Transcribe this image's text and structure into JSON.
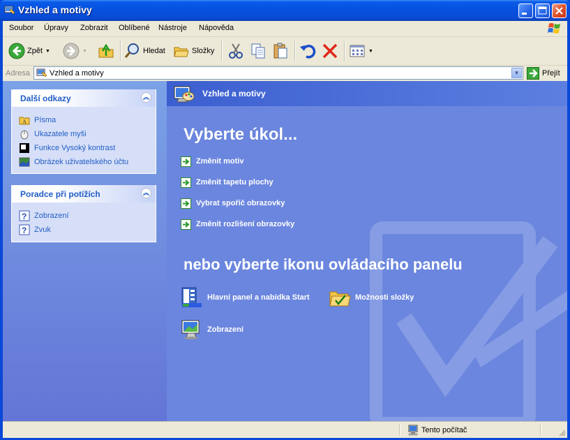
{
  "window": {
    "title": "Vzhled a motivy"
  },
  "menu": [
    "Soubor",
    "Úpravy",
    "Zobrazit",
    "Oblíbené",
    "Nástroje",
    "Nápověda"
  ],
  "toolbar": {
    "back": "Zpět",
    "search": "Hledat",
    "folders": "Složky"
  },
  "address": {
    "label": "Adresa",
    "value": "Vzhled a motivy",
    "go": "Přejít"
  },
  "sidebar": {
    "links_title": "Další odkazy",
    "links": [
      "Písma",
      "Ukazatele myši",
      "Funkce Vysoký kontrast",
      "Obrázek uživatelského účtu"
    ],
    "trouble_title": "Poradce při potížích",
    "trouble": [
      "Zobrazení",
      "Zvuk"
    ]
  },
  "main": {
    "header": "Vzhled a motivy",
    "pick_task": "Vyberte úkol...",
    "tasks": [
      "Změnit motiv",
      "Změnit tapetu plochy",
      "Vybrat spořič obrazovky",
      "Změnit rozlišení obrazovky"
    ],
    "pick_icon": "nebo vyberte ikonu ovládacího panelu",
    "icons": [
      "Hlavní panel a nabídka Start",
      "Možnosti složky",
      "Zobrazení"
    ]
  },
  "status": {
    "zone": "Tento počítač"
  }
}
